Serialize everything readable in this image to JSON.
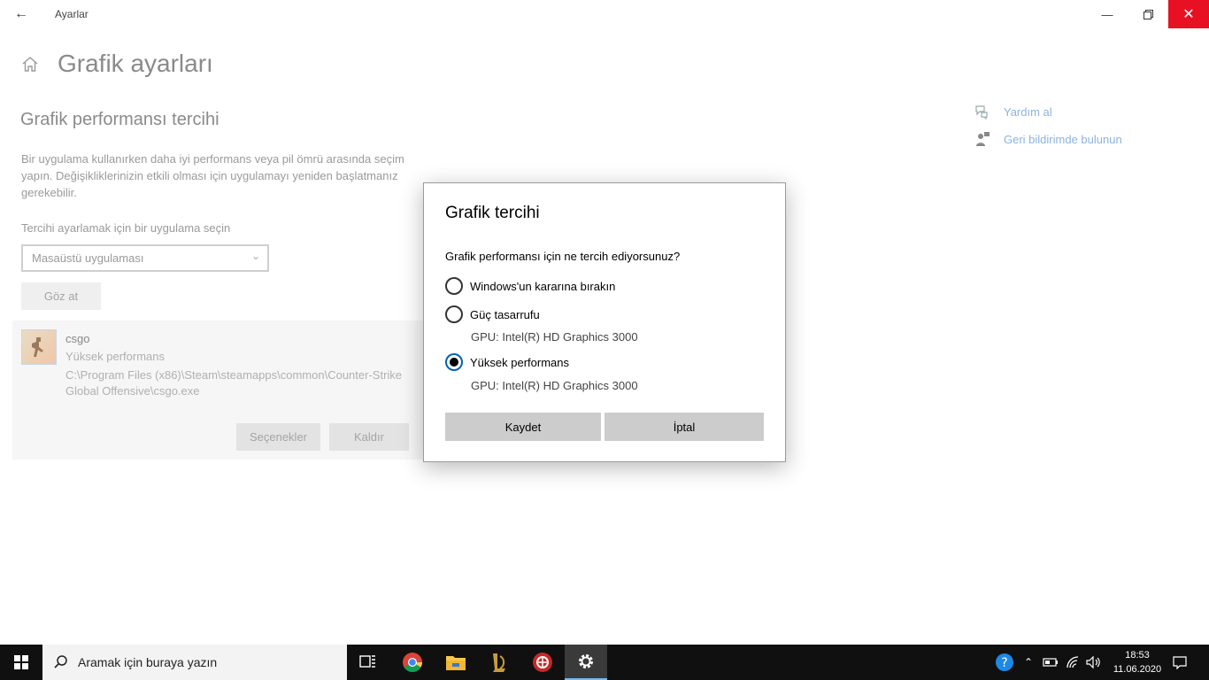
{
  "window": {
    "app_title": "Ayarlar",
    "back_icon": "back-arrow-icon",
    "minimize_icon": "minimize-icon",
    "restore_icon": "restore-icon",
    "close_icon": "close-icon",
    "close_color": "#e81123"
  },
  "page": {
    "title": "Grafik ayarları",
    "section_title": "Grafik performansı tercihi",
    "description": "Bir uygulama kullanırken daha iyi performans veya pil ömrü arasında seçim yapın. Değişikliklerinizin etkili olması için uygulamayı yeniden başlatmanız gerekebilir.",
    "select_label": "Tercihi ayarlamak için bir uygulama seçin",
    "select_value": "Masaüstü uygulaması",
    "browse_label": "Göz at"
  },
  "app_entry": {
    "name": "csgo",
    "preference": "Yüksek performans",
    "path": "C:\\Program Files (x86)\\Steam\\steamapps\\common\\Counter-Strike Global Offensive\\csgo.exe",
    "options_label": "Seçenekler",
    "remove_label": "Kaldır"
  },
  "side_links": {
    "help": "Yardım al",
    "feedback": "Geri bildirimde bulunun",
    "link_color": "#8bb3e0"
  },
  "dialog": {
    "title": "Grafik tercihi",
    "question": "Grafik performansı için ne tercih ediyorsunuz?",
    "options": [
      {
        "label": "Windows'un kararına bırakın",
        "gpu": "",
        "checked": false
      },
      {
        "label": "Güç tasarrufu",
        "gpu": "GPU: Intel(R) HD Graphics 3000",
        "checked": false
      },
      {
        "label": "Yüksek performans",
        "gpu": "GPU: Intel(R) HD Graphics 3000",
        "checked": true
      }
    ],
    "save_label": "Kaydet",
    "cancel_label": "İptal"
  },
  "taskbar": {
    "search_placeholder": "Aramak için buraya yazın",
    "apps": [
      "task-view-icon",
      "chrome-icon",
      "file-explorer-icon",
      "league-of-legends-icon",
      "antivirus-icon",
      "settings-icon"
    ],
    "active_app": "settings-icon",
    "time": "18:53",
    "date": "11.06.2020"
  }
}
